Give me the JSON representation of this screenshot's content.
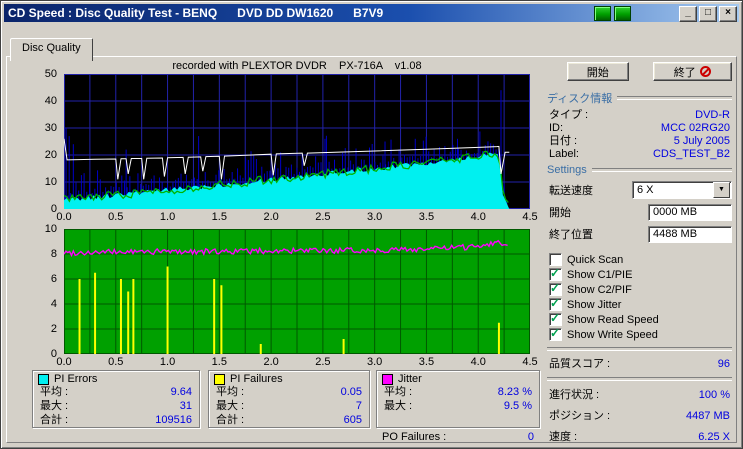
{
  "window": {
    "title": "CD Speed : Disc Quality Test - BENQ      DVD DD DW1620      B7V9"
  },
  "icons": {
    "minimize": "_",
    "maximize": "□",
    "close": "×",
    "dropdown": "▼",
    "check": "✓"
  },
  "tab": {
    "label": "Disc Quality"
  },
  "header_note": "recorded with PLEXTOR DVDR    PX-716A    v1.08",
  "actions": {
    "start_button": "開始",
    "exit_button": "終了"
  },
  "disc_info": {
    "header": "ディスク情報",
    "rows": [
      {
        "label": "タイプ :",
        "value": "DVD-R"
      },
      {
        "label": "ID:",
        "value": "MCC 02RG20"
      },
      {
        "label": "日付 :",
        "value": "5 July 2005"
      },
      {
        "label": "Label:",
        "value": "CDS_TEST_B2"
      }
    ]
  },
  "settings": {
    "header": "Settings",
    "speed": {
      "label": "転送速度",
      "value": "6 X"
    },
    "start": {
      "label": "開始",
      "value": "0000 MB"
    },
    "end": {
      "label": "終了位置",
      "value": "4488 MB"
    },
    "checkboxes": [
      {
        "label": "Quick Scan",
        "checked": false
      },
      {
        "label": "Show C1/PIE",
        "checked": true
      },
      {
        "label": "Show C2/PIF",
        "checked": true
      },
      {
        "label": "Show Jitter",
        "checked": true
      },
      {
        "label": "Show Read Speed",
        "checked": true
      },
      {
        "label": "Show Write Speed",
        "checked": true
      }
    ]
  },
  "score": {
    "label": "品質スコア :",
    "value": "96"
  },
  "status_rows": [
    {
      "label": "進行状況 :",
      "value": "100 %"
    },
    {
      "label": "ポジション :",
      "value": "4487 MB"
    },
    {
      "label": "速度 :",
      "value": "6.25 X"
    }
  ],
  "legend": {
    "boxes": [
      {
        "title": "PI Errors",
        "swatch": "#00f0f0",
        "rows": [
          {
            "label": "平均 :",
            "value": "9.64"
          },
          {
            "label": "最大 :",
            "value": "31"
          },
          {
            "label": "合計 :",
            "value": "109516"
          }
        ]
      },
      {
        "title": "PI Failures",
        "swatch": "#ffff00",
        "rows": [
          {
            "label": "平均 :",
            "value": "0.05"
          },
          {
            "label": "最大 :",
            "value": "7"
          },
          {
            "label": "合計 :",
            "value": "605"
          }
        ]
      },
      {
        "title": "Jitter",
        "swatch": "#ff00ff",
        "rows": [
          {
            "label": "平均 :",
            "value": "8.23 %"
          },
          {
            "label": "最大 :",
            "value": "9.5 %"
          }
        ]
      }
    ],
    "po_failures": {
      "label": "PO Failures :",
      "value": "0"
    }
  },
  "chart_data": [
    {
      "type": "area",
      "title": "PI Errors vs disc position (GB)",
      "xlim": [
        0,
        4.5
      ],
      "ylim": [
        0,
        50
      ],
      "x_tick_labels": [
        "0.0",
        "0.5",
        "1.0",
        "1.5",
        "2.0",
        "2.5",
        "3.0",
        "3.5",
        "4.0",
        "4.5"
      ],
      "y_tick_values": [
        50,
        40,
        30,
        20,
        10,
        0
      ],
      "grid_x_step": 0.25,
      "grid_y_step": 10,
      "bg_color": "#000000",
      "grid_color": "#2222aa",
      "data_end_x": 4.3,
      "series": [
        {
          "name": "pi_errors_area",
          "color": "#00f0f0",
          "noise": 1.0,
          "anchors": [
            [
              0,
              3.5
            ],
            [
              0.5,
              5.2
            ],
            [
              1,
              7
            ],
            [
              1.5,
              9
            ],
            [
              2,
              11
            ],
            [
              2.5,
              13
            ],
            [
              3,
              15
            ],
            [
              3.5,
              17.2
            ],
            [
              4,
              19.6
            ],
            [
              4.2,
              21
            ],
            [
              4.24,
              5
            ],
            [
              4.3,
              0.5
            ]
          ]
        },
        {
          "name": "pi_errors_peaks",
          "color": "#0000c8",
          "spike_extra_max": 9,
          "extra_spikes": [
            [
              0.02,
              30
            ],
            [
              0.05,
              27
            ],
            [
              0.09,
              24
            ],
            [
              0.6,
              22
            ],
            [
              1.3,
              27
            ],
            [
              2.52,
              26
            ],
            [
              3.1,
              25
            ],
            [
              3.8,
              26
            ],
            [
              4.22,
              44
            ]
          ]
        },
        {
          "name": "green_overlay_line",
          "color": "#00b400",
          "noise": 1.6
        },
        {
          "name": "white_overlay_line",
          "color": "#ffffff",
          "points": [
            [
              0,
              26
            ],
            [
              0.03,
              18.2
            ],
            [
              0.3,
              18.4
            ],
            [
              0.5,
              18.5
            ],
            [
              0.52,
              11
            ],
            [
              0.55,
              18.6
            ],
            [
              0.6,
              18.6
            ],
            [
              0.62,
              13
            ],
            [
              0.65,
              18.7
            ],
            [
              0.75,
              18.7
            ],
            [
              0.77,
              11
            ],
            [
              0.8,
              18.8
            ],
            [
              0.95,
              18.9
            ],
            [
              0.97,
              12
            ],
            [
              1.0,
              19
            ],
            [
              1.15,
              19.1
            ],
            [
              1.17,
              13
            ],
            [
              1.2,
              19.2
            ],
            [
              1.32,
              19.3
            ],
            [
              1.34,
              14
            ],
            [
              1.37,
              19.4
            ],
            [
              1.5,
              19.5
            ],
            [
              1.52,
              11
            ],
            [
              1.55,
              19.6
            ],
            [
              2.0,
              20.3
            ],
            [
              2.02,
              12.5
            ],
            [
              2.05,
              20.4
            ],
            [
              2.3,
              20.7
            ],
            [
              2.32,
              16
            ],
            [
              2.35,
              20.7
            ],
            [
              3.0,
              21.5
            ],
            [
              3.5,
              22.1
            ],
            [
              4.0,
              22.8
            ],
            [
              4.18,
              23.1
            ],
            [
              4.2,
              23.2
            ],
            [
              4.22,
              13
            ],
            [
              4.26,
              21
            ],
            [
              4.3,
              21
            ]
          ]
        }
      ]
    },
    {
      "type": "line",
      "title": "Jitter / PI Failures vs disc position (GB)",
      "xlim": [
        0,
        4.5
      ],
      "ylim": [
        0,
        10
      ],
      "x_tick_labels": [
        "0.0",
        "0.5",
        "1.0",
        "1.5",
        "2.0",
        "2.5",
        "3.0",
        "3.5",
        "4.0",
        "4.5"
      ],
      "y_tick_values": [
        10,
        8,
        6,
        4,
        2,
        0
      ],
      "grid_x_step": 0.25,
      "grid_y_step": 2,
      "bg_color": "#00a000",
      "grid_color": "#005800",
      "data_end_x": 4.3,
      "series": [
        {
          "name": "jitter_percent",
          "color": "#ff00ff",
          "noise": 0.22,
          "anchors": [
            [
              0,
              8.1
            ],
            [
              0.5,
              8.15
            ],
            [
              1,
              8.2
            ],
            [
              1.5,
              8.2
            ],
            [
              2,
              8.25
            ],
            [
              2.5,
              8.25
            ],
            [
              3,
              8.3
            ],
            [
              3.5,
              8.4
            ],
            [
              3.9,
              8.55
            ],
            [
              4.1,
              8.8
            ],
            [
              4.2,
              9.0
            ],
            [
              4.3,
              8.5
            ]
          ]
        },
        {
          "name": "pi_failures_spikes",
          "color": "#ffff00",
          "spikes": [
            [
              0.15,
              6
            ],
            [
              0.3,
              6.5
            ],
            [
              0.55,
              6
            ],
            [
              0.62,
              5
            ],
            [
              0.67,
              6
            ],
            [
              1.0,
              7
            ],
            [
              1.45,
              6
            ],
            [
              1.52,
              5.5
            ],
            [
              1.9,
              0.8
            ],
            [
              2.7,
              1.2
            ],
            [
              4.2,
              2.5
            ]
          ]
        }
      ]
    }
  ]
}
